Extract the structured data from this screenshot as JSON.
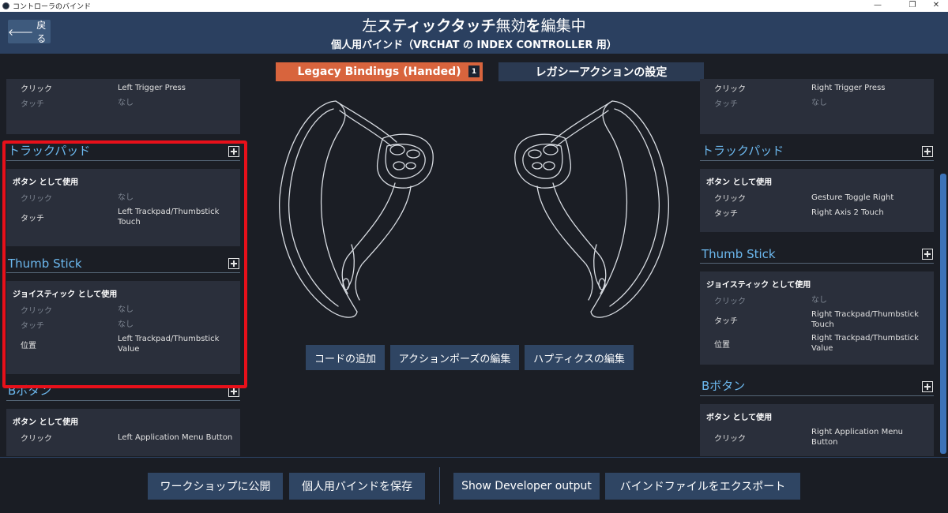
{
  "window": {
    "title": "コントローラのバインド"
  },
  "header": {
    "back_label": "戻る",
    "title_prefix": "左",
    "title_bold": "スティックタッチ",
    "title_mid": "無効",
    "title_bold2": "を",
    "title_suffix": "編集中",
    "subtitle": "個人用バインド（VRCHAT の INDEX CONTROLLER 用）"
  },
  "tabs": {
    "legacy": {
      "label": "Legacy Bindings (Handed)",
      "count": "1"
    },
    "actions": {
      "label": "レガシーアクションの設定"
    }
  },
  "left": {
    "top_card": {
      "rows": [
        {
          "k": "クリック",
          "v": "Left Trigger Press"
        },
        {
          "k": "タッチ",
          "v": "なし"
        }
      ]
    },
    "trackpad": {
      "title": "トラックパッド",
      "mode": "ボタン として使用",
      "rows": [
        {
          "k": "クリック",
          "v": "なし"
        },
        {
          "k": "タッチ",
          "v": "Left Trackpad/Thumbstick Touch"
        }
      ]
    },
    "thumbstick": {
      "title": "Thumb Stick",
      "mode": "ジョイスティック として使用",
      "rows": [
        {
          "k": "クリック",
          "v": "なし"
        },
        {
          "k": "タッチ",
          "v": "なし"
        },
        {
          "k": "位置",
          "v": "Left Trackpad/Thumbstick Value"
        }
      ]
    },
    "b_button": {
      "title": "Bボタン",
      "mode": "ボタン として使用",
      "rows": [
        {
          "k": "クリック",
          "v": "Left Application Menu Button"
        }
      ]
    }
  },
  "right": {
    "top_card": {
      "rows": [
        {
          "k": "クリック",
          "v": "Right Trigger Press"
        },
        {
          "k": "タッチ",
          "v": "なし"
        }
      ]
    },
    "trackpad": {
      "title": "トラックパッド",
      "mode": "ボタン として使用",
      "rows": [
        {
          "k": "クリック",
          "v": "Gesture Toggle Right"
        },
        {
          "k": "タッチ",
          "v": "Right Axis 2 Touch"
        }
      ]
    },
    "thumbstick": {
      "title": "Thumb Stick",
      "mode": "ジョイスティック として使用",
      "rows": [
        {
          "k": "クリック",
          "v": "なし"
        },
        {
          "k": "タッチ",
          "v": "Right Trackpad/Thumbstick Touch"
        },
        {
          "k": "位置",
          "v": "Right Trackpad/Thumbstick Value"
        }
      ]
    },
    "b_button": {
      "title": "Bボタン",
      "mode": "ボタン として使用",
      "rows": [
        {
          "k": "クリック",
          "v": "Right Application Menu Button"
        }
      ]
    }
  },
  "center": {
    "add_chord": "コードの追加",
    "edit_pose": "アクションポーズの編集",
    "edit_haptics": "ハプティクスの編集"
  },
  "footer": {
    "publish": "ワークショップに公開",
    "save": "個人用バインドを保存",
    "dev_output": "Show Developer output",
    "export": "バインドファイルをエクスポート"
  },
  "colors": {
    "accent_tab": "#d8643d",
    "header_bg": "#2b4060",
    "section_title": "#6cb8ee",
    "highlight": "#e8101a"
  }
}
